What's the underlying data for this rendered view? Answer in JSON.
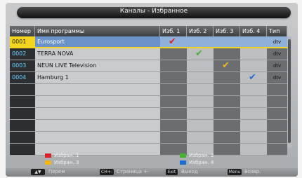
{
  "window": {
    "title": "Каналы - Избранное"
  },
  "columns": {
    "number": "Номер",
    "program": "Имя программы",
    "fav1": "Изб. 1",
    "fav2": "Изб. 2",
    "fav3": "Изб. 3",
    "fav4": "Изб. 4",
    "type": "Тип"
  },
  "channels": [
    {
      "number": "0001",
      "name": "Eurosport",
      "favs": [
        1,
        0,
        0,
        0
      ],
      "type": "dtv",
      "selected": true
    },
    {
      "number": "0002",
      "name": "TERRA NOVA",
      "favs": [
        0,
        1,
        0,
        0
      ],
      "type": "dtv"
    },
    {
      "number": "0003",
      "name": "NEUN LIVE Television",
      "favs": [
        0,
        0,
        1,
        0
      ],
      "type": "dtv"
    },
    {
      "number": "0004",
      "name": "Hamburg 1",
      "favs": [
        0,
        0,
        0,
        1
      ],
      "type": "dtv"
    }
  ],
  "colors": {
    "fav1": "#d9232a",
    "fav2": "#45b233",
    "fav3": "#f2b61b",
    "fav4": "#1f6fd1"
  },
  "legend": {
    "fav1": "Избран. 1",
    "fav2": "Избран. 2",
    "fav3": "Избран. 3",
    "fav4": "Избран. 4"
  },
  "footer": {
    "move_key": "▲▼",
    "move_label": "Перем",
    "page_key": "CH+-",
    "page_label": "Страница +-",
    "exit_key": "Exit",
    "exit_label": "Выход",
    "menu_key": "Menu",
    "menu_label": "Возвр."
  }
}
